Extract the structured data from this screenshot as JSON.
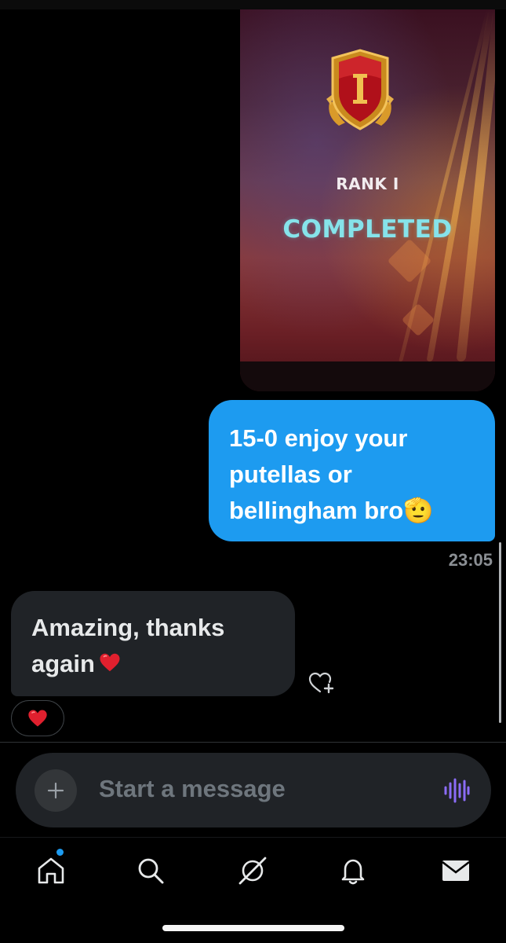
{
  "shared_image": {
    "rank_label": "RANK I",
    "status": "COMPLETED",
    "badge_numeral": "I"
  },
  "messages": [
    {
      "direction": "outgoing",
      "text": "15-0 enjoy your\nputellas or\nbellingham bro🫡",
      "time": "23:05"
    },
    {
      "direction": "incoming",
      "text": "Amazing, thanks\nagain",
      "trailing_emoji": "heart",
      "reaction": "❤️"
    }
  ],
  "composer": {
    "placeholder": "Start a message",
    "add_icon": "plus-icon",
    "voice_icon": "voice-wave-icon"
  },
  "nav": {
    "items": [
      "home-icon",
      "search-icon",
      "grok-icon",
      "bell-icon",
      "mail-icon"
    ],
    "active": "home-icon",
    "home_notification_dot": true
  },
  "colors": {
    "accent": "#1d9bf0",
    "incoming_bubble": "#202327",
    "completed_text": "#86e3ea",
    "voice_icon": "#8b6cf7",
    "heart": "#e0245e"
  }
}
